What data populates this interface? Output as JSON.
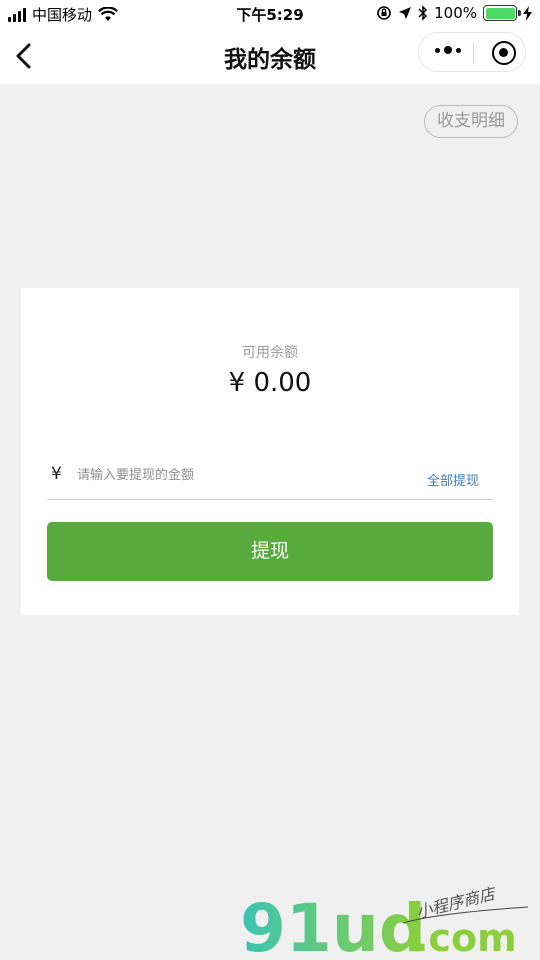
{
  "status_bar": {
    "carrier": "中国移动",
    "time": "下午5:29",
    "battery_percent": "100%",
    "battery_level": 1.0
  },
  "nav": {
    "title": "我的余额"
  },
  "detail_button": "收支明细",
  "balance": {
    "label": "可用余额",
    "amount": "¥ 0.00"
  },
  "withdraw_form": {
    "currency_symbol": "¥",
    "amount_placeholder": "请输入要提现的金额",
    "amount_value": "",
    "withdraw_all_label": "全部提现",
    "submit_label": "提现"
  },
  "watermark": {
    "brand": "91ud",
    "domain": ".com",
    "tagline": "小程序商店"
  },
  "colors": {
    "primary_green": "#56ab3c",
    "link_blue": "#3f79c5",
    "page_bg": "#f0f0f0",
    "watermark_teal": "#3cc4b4",
    "watermark_green": "#8ccf3c"
  }
}
